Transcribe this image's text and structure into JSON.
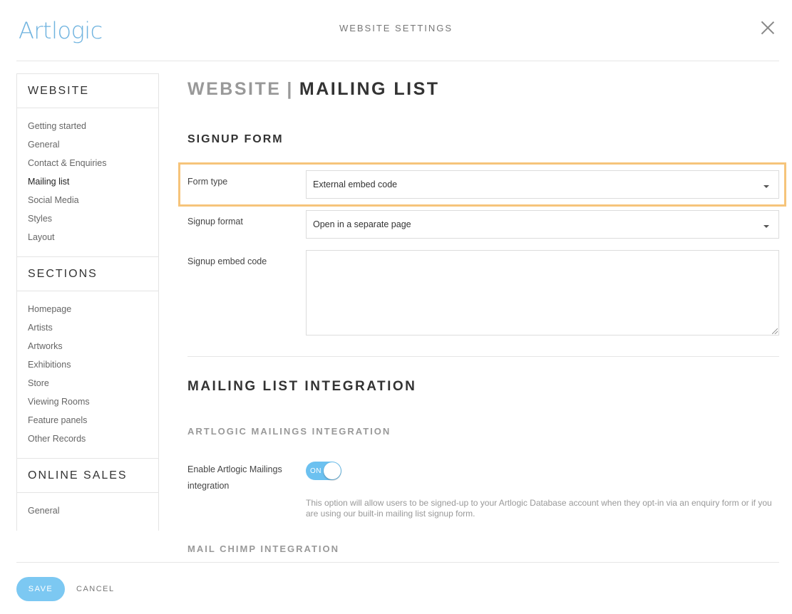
{
  "header": {
    "logo": "Artlogic",
    "title": "WEBSITE SETTINGS"
  },
  "sidebar": {
    "groups": [
      {
        "heading": "WEBSITE",
        "items": [
          "Getting started",
          "General",
          "Contact & Enquiries",
          "Mailing list",
          "Social Media",
          "Styles",
          "Layout"
        ]
      },
      {
        "heading": "SECTIONS",
        "items": [
          "Homepage",
          "Artists",
          "Artworks",
          "Exhibitions",
          "Store",
          "Viewing Rooms",
          "Feature panels",
          "Other Records"
        ]
      },
      {
        "heading": "ONLINE SALES",
        "items": [
          "General"
        ]
      }
    ],
    "active_item": "Mailing list"
  },
  "main": {
    "title_prefix": "WEBSITE",
    "title_separator": "|",
    "title": "MAILING LIST",
    "signup": {
      "heading": "SIGNUP FORM",
      "form_type_label": "Form type",
      "form_type_value": "External embed code",
      "signup_format_label": "Signup format",
      "signup_format_value": "Open in a separate page",
      "embed_code_label": "Signup embed code",
      "embed_code_value": ""
    },
    "integration": {
      "heading": "MAILING LIST INTEGRATION",
      "artlogic_heading": "ARTLOGIC MAILINGS INTEGRATION",
      "enable_label_line1": "Enable Artlogic Mailings",
      "enable_label_line2": "integration",
      "toggle_text": "ON",
      "toggle_on": true,
      "help_text": "This option will allow users to be signed-up to your Artlogic Database account when they opt-in via an enquiry form or if you are using our built-in mailing list signup form.",
      "mailchimp_heading": "MAIL CHIMP INTEGRATION"
    }
  },
  "footer": {
    "save_label": "SAVE",
    "cancel_label": "CANCEL"
  },
  "colors": {
    "accent": "#6fb3df",
    "toggle_on": "#6cc1f0",
    "save_button": "#7cc8f2",
    "highlight_border": "#f6c47a"
  }
}
